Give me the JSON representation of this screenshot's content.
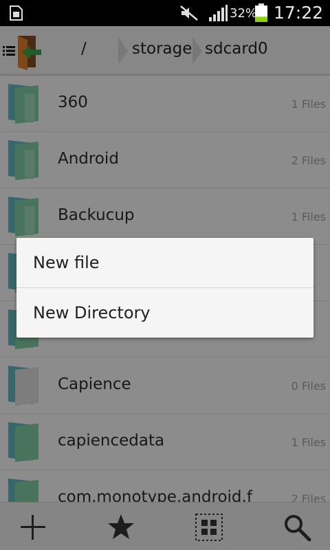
{
  "status_bar": {
    "battery_percent": "32%",
    "time": "17:22",
    "battery_level": 0.32,
    "icons": [
      "sim-card-icon",
      "mute-icon",
      "signal-icon",
      "battery-icon"
    ]
  },
  "toolbar": {
    "breadcrumbs": [
      "/",
      "storage",
      "sdcard0"
    ],
    "icons": [
      "menu-icon",
      "app-exit-icon"
    ]
  },
  "files": [
    {
      "name": "360",
      "count": "1 Files"
    },
    {
      "name": "Android",
      "count": "2 Files"
    },
    {
      "name": "Backucup",
      "count": "1 Files"
    },
    {
      "name": "",
      "count": ""
    },
    {
      "name": "",
      "count": ""
    },
    {
      "name": "Capience",
      "count": "0 Files"
    },
    {
      "name": "capiencedata",
      "count": "1 Files"
    },
    {
      "name": "com.monotype.android.f",
      "count": "2 Files"
    }
  ],
  "popup_menu": {
    "items": [
      "New file",
      "New Directory"
    ]
  },
  "bottom_bar": {
    "icons": [
      "add-icon",
      "star-icon",
      "select-grid-icon",
      "search-icon"
    ]
  },
  "colors": {
    "status_bar_bg": "#000000",
    "battery_fill": "#8fd400",
    "folder_teal": "#5fb0b8",
    "folder_green": "#6fbf8f"
  }
}
